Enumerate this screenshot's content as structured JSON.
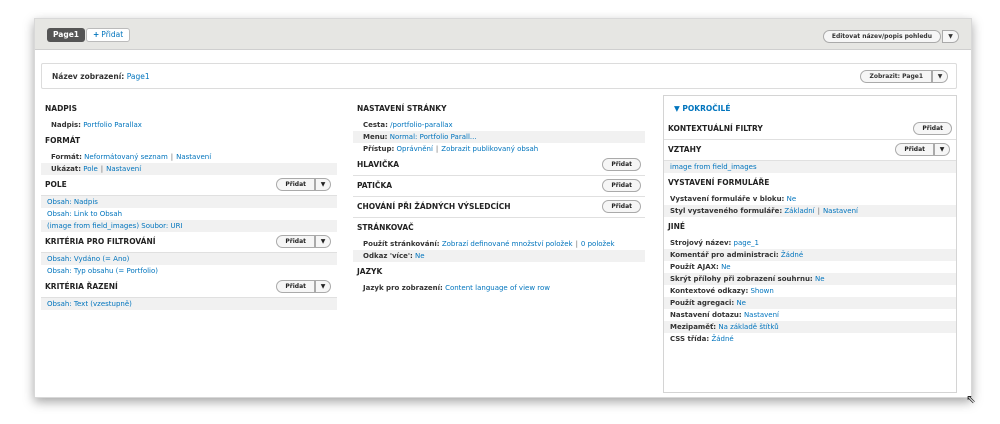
{
  "topbar": {
    "page_tab": "Page1",
    "add_tab": "Přidat",
    "edit_button": "Editovat název/popis pohledu"
  },
  "namebar": {
    "label": "Název zobrazení:",
    "value": "Page1",
    "show_button": "Zobrazit: Page1"
  },
  "col1": {
    "title_head": "NADPIS",
    "title_label": "Nadpis:",
    "title_value": "Portfolio Parallax",
    "format_head": "FORMÁT",
    "format_label": "Formát:",
    "format_value": "Neformátovaný seznam",
    "format_settings": "Nastavení",
    "show_label": "Ukázat:",
    "show_value": "Pole",
    "show_settings": "Nastavení",
    "fields_head": "POLE",
    "fields_add": "Přidat",
    "fields": [
      "Obsah: Nadpis",
      "Obsah: Link to Obsah",
      "(image from field_images) Soubor: URI"
    ],
    "filters_head": "KRITÉRIA PRO FILTROVÁNÍ",
    "filters_add": "Přidat",
    "filters": [
      "Obsah: Vydáno (= Ano)",
      "Obsah: Typ obsahu (= Portfolio)"
    ],
    "sort_head": "KRITÉRIA ŘAZENÍ",
    "sort_add": "Přidat",
    "sorts": [
      "Obsah: Text (vzestupně)"
    ]
  },
  "col2": {
    "page_head": "NASTAVENÍ STRÁNKY",
    "path_label": "Cesta:",
    "path_value": "/portfolio-parallax",
    "menu_label": "Menu:",
    "menu_value": "Normal: Portfolio Parall...",
    "access_label": "Přístup:",
    "access_value": "Oprávnění",
    "access_link": "Zobrazit publikovaný obsah",
    "header_head": "HLAVIČKA",
    "header_add": "Přidat",
    "footer_head": "PATIČKA",
    "footer_add": "Přidat",
    "empty_head": "CHOVÁNÍ PŘI ŽÁDNÝCH VÝSLEDCÍCH",
    "empty_add": "Přidat",
    "pager_head": "STRÁNKOVAČ",
    "pager_label": "Použít stránkování:",
    "pager_value": "Zobrazí definované množství položek",
    "pager_count": "0 položek",
    "more_label": "Odkaz 'více':",
    "more_value": "Ne",
    "lang_head": "JAZYK",
    "lang_label": "Jazyk pro zobrazení:",
    "lang_value": "Content language of view row"
  },
  "col3": {
    "advanced": "POKROČILÉ",
    "ctx_head": "KONTEXTUÁLNÍ FILTRY",
    "ctx_add": "Přidat",
    "rel_head": "VZTAHY",
    "rel_add": "Přidat",
    "rel_item": "image from field_images",
    "form_head": "VYSTAVENÍ FORMULÁŘE",
    "form_block_label": "Vystavení formuláře v bloku:",
    "form_block_value": "Ne",
    "form_style_label": "Styl vystaveného formuláře:",
    "form_style_value": "Základní",
    "form_style_settings": "Nastavení",
    "other_head": "JINÉ",
    "machine_label": "Strojový název:",
    "machine_value": "page_1",
    "admin_label": "Komentář pro administraci:",
    "admin_value": "Žádné",
    "ajax_label": "Použít AJAX:",
    "ajax_value": "Ne",
    "hide_label": "Skrýt přílohy při zobrazení souhrnu:",
    "hide_value": "Ne",
    "ctxlinks_label": "Kontextové odkazy:",
    "ctxlinks_value": "Shown",
    "agg_label": "Použít agregaci:",
    "agg_value": "Ne",
    "query_label": "Nastavení dotazu:",
    "query_value": "Nastavení",
    "cache_label": "Mezipaměť:",
    "cache_value": "Na základě štítků",
    "css_label": "CSS třída:",
    "css_value": "Žádné"
  }
}
